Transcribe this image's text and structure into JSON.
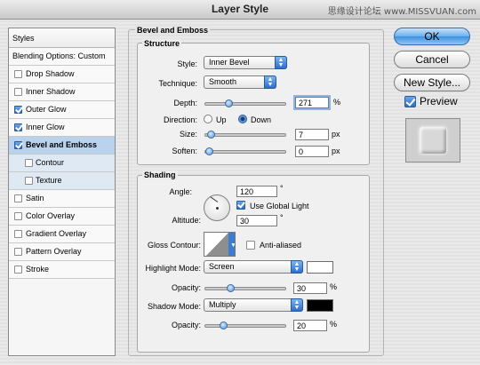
{
  "window": {
    "title": "Layer Style",
    "watermark": "思缘设计论坛 www.MISSVUAN.com"
  },
  "sidebar": {
    "styles_label": "Styles",
    "blending_label": "Blending Options: Custom",
    "items": [
      {
        "label": "Drop Shadow",
        "checked": false
      },
      {
        "label": "Inner Shadow",
        "checked": false
      },
      {
        "label": "Outer Glow",
        "checked": true
      },
      {
        "label": "Inner Glow",
        "checked": true
      },
      {
        "label": "Bevel and Emboss",
        "checked": true,
        "selected": true
      },
      {
        "label": "Contour",
        "checked": false,
        "sub": true
      },
      {
        "label": "Texture",
        "checked": false,
        "sub": true
      },
      {
        "label": "Satin",
        "checked": false
      },
      {
        "label": "Color Overlay",
        "checked": false
      },
      {
        "label": "Gradient Overlay",
        "checked": false
      },
      {
        "label": "Pattern Overlay",
        "checked": false
      },
      {
        "label": "Stroke",
        "checked": false
      }
    ]
  },
  "bevel": {
    "section_title": "Bevel and Emboss",
    "structure_title": "Structure",
    "style_label": "Style:",
    "style_value": "Inner Bevel",
    "technique_label": "Technique:",
    "technique_value": "Smooth",
    "depth_label": "Depth:",
    "depth_value": "271",
    "depth_unit": "%",
    "depth_level": 0.27,
    "direction_label": "Direction:",
    "direction_up": "Up",
    "direction_down": "Down",
    "direction_selected": "Down",
    "size_label": "Size:",
    "size_value": "7",
    "size_unit": "px",
    "size_level": 0.03,
    "soften_label": "Soften:",
    "soften_value": "0",
    "soften_unit": "px",
    "soften_level": 0.0
  },
  "shading": {
    "title": "Shading",
    "angle_label": "Angle:",
    "angle_value": "120",
    "angle_unit": "°",
    "global_light_label": "Use Global Light",
    "global_light_checked": true,
    "altitude_label": "Altitude:",
    "altitude_value": "30",
    "altitude_unit": "°",
    "gloss_label": "Gloss Contour:",
    "anti_aliased_label": "Anti-aliased",
    "anti_aliased_checked": false,
    "highlight_mode_label": "Highlight Mode:",
    "highlight_mode_value": "Screen",
    "highlight_color": "#ffffff",
    "highlight_opacity_label": "Opacity:",
    "highlight_opacity_value": "30",
    "highlight_opacity_unit": "%",
    "highlight_opacity_level": 0.3,
    "shadow_mode_label": "Shadow Mode:",
    "shadow_mode_value": "Multiply",
    "shadow_color": "#000000",
    "shadow_opacity_label": "Opacity:",
    "shadow_opacity_value": "20",
    "shadow_opacity_unit": "%",
    "shadow_opacity_level": 0.2
  },
  "buttons": {
    "ok": "OK",
    "cancel": "Cancel",
    "new_style": "New Style...",
    "preview": "Preview",
    "preview_checked": true
  },
  "colors": {
    "accent": "#3f8fdc",
    "selected_row": "#b9d3ee"
  }
}
